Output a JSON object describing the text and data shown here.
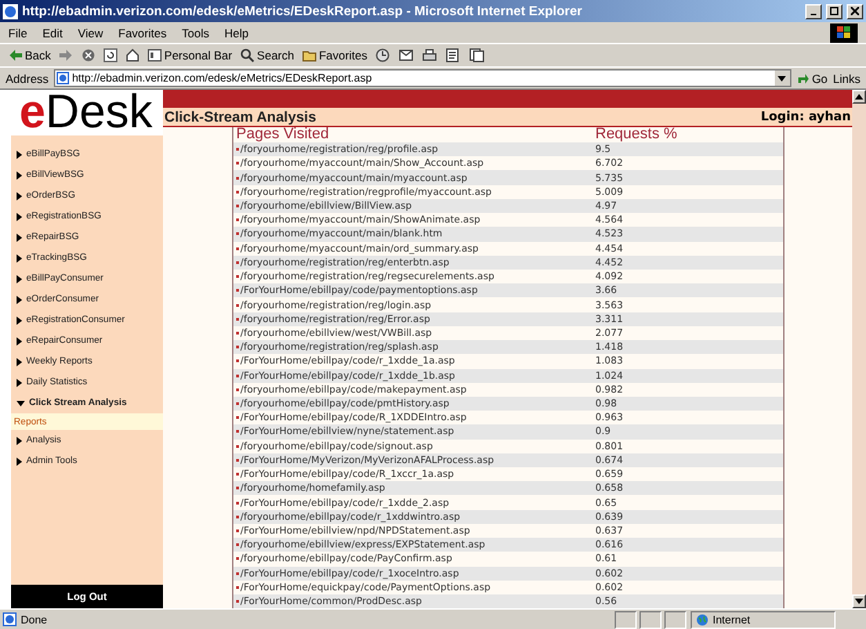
{
  "window": {
    "title": "http://ebadmin.verizon.com/edesk/eMetrics/EDeskReport.asp - Microsoft Internet Explorer"
  },
  "menu": [
    "File",
    "Edit",
    "View",
    "Favorites",
    "Tools",
    "Help"
  ],
  "toolbar": {
    "buttons": [
      {
        "label": "Back"
      },
      {
        "label": "Personal Bar"
      },
      {
        "label": "Search"
      },
      {
        "label": "Favorites"
      }
    ]
  },
  "address_bar": {
    "label": "Address",
    "value": "http://ebadmin.verizon.com/edesk/eMetrics/EDeskReport.asp",
    "go": "Go",
    "links": "Links"
  },
  "page": {
    "logo": {
      "accent": "e",
      "text": "Desk"
    },
    "heading": "Click-Stream Analysis",
    "login": "Login: ayhan",
    "sidebar": {
      "items": [
        {
          "label": "eBillPayBSG",
          "expanded": false,
          "selected": false
        },
        {
          "label": "eBillViewBSG",
          "expanded": false,
          "selected": false
        },
        {
          "label": "eOrderBSG",
          "expanded": false,
          "selected": false
        },
        {
          "label": "eRegistrationBSG",
          "expanded": false,
          "selected": false
        },
        {
          "label": "eRepairBSG",
          "expanded": false,
          "selected": false
        },
        {
          "label": "eTrackingBSG",
          "expanded": false,
          "selected": false
        },
        {
          "label": "eBillPayConsumer",
          "expanded": false,
          "selected": false
        },
        {
          "label": "eOrderConsumer",
          "expanded": false,
          "selected": false
        },
        {
          "label": "eRegistrationConsumer",
          "expanded": false,
          "selected": false
        },
        {
          "label": "eRepairConsumer",
          "expanded": false,
          "selected": false
        },
        {
          "label": "Weekly Reports",
          "expanded": false,
          "selected": false
        },
        {
          "label": "Daily Statistics",
          "expanded": false,
          "selected": false
        },
        {
          "label": "Click Stream Analysis",
          "expanded": true,
          "selected": false,
          "children": [
            {
              "label": "Reports",
              "selected": true
            }
          ]
        },
        {
          "label": "Analysis",
          "expanded": false,
          "selected": false
        },
        {
          "label": "Admin Tools",
          "expanded": false,
          "selected": false
        }
      ],
      "logout": "Log Out"
    },
    "table": {
      "columns": [
        "Pages Visited",
        "Requests %"
      ],
      "rows": [
        [
          "/foryourhome/registration/reg/profile.asp",
          "9.5"
        ],
        [
          "/foryourhome/myaccount/main/Show_Account.asp",
          "6.702"
        ],
        [
          "/foryourhome/myaccount/main/myaccount.asp",
          "5.735"
        ],
        [
          "/foryourhome/registration/regprofile/myaccount.asp",
          "5.009"
        ],
        [
          "/foryourhome/ebillview/BillView.asp",
          "4.97"
        ],
        [
          "/foryourhome/myaccount/main/ShowAnimate.asp",
          "4.564"
        ],
        [
          "/foryourhome/myaccount/main/blank.htm",
          "4.523"
        ],
        [
          "/foryourhome/myaccount/main/ord_summary.asp",
          "4.454"
        ],
        [
          "/foryourhome/registration/reg/enterbtn.asp",
          "4.452"
        ],
        [
          "/foryourhome/registration/reg/regsecurelements.asp",
          "4.092"
        ],
        [
          "/ForYourHome/ebillpay/code/paymentoptions.asp",
          "3.66"
        ],
        [
          "/foryourhome/registration/reg/login.asp",
          "3.563"
        ],
        [
          "/foryourhome/registration/reg/Error.asp",
          "3.311"
        ],
        [
          "/foryourhome/ebillview/west/VWBill.asp",
          "2.077"
        ],
        [
          "/foryourhome/registration/reg/splash.asp",
          "1.418"
        ],
        [
          "/ForYourHome/ebillpay/code/r_1xdde_1a.asp",
          "1.083"
        ],
        [
          "/ForYourHome/ebillpay/code/r_1xdde_1b.asp",
          "1.024"
        ],
        [
          "/foryourhome/ebillpay/code/makepayment.asp",
          "0.982"
        ],
        [
          "/foryourhome/ebillpay/code/pmtHistory.asp",
          "0.98"
        ],
        [
          "/ForYourHome/ebillpay/code/R_1XDDEIntro.asp",
          "0.963"
        ],
        [
          "/ForYourHome/ebillview/nyne/statement.asp",
          "0.9"
        ],
        [
          "/foryourhome/ebillpay/code/signout.asp",
          "0.801"
        ],
        [
          "/ForYourHome/MyVerizon/MyVerizonAFALProcess.asp",
          "0.674"
        ],
        [
          "/ForYourHome/ebillpay/code/R_1xccr_1a.asp",
          "0.659"
        ],
        [
          "/foryourhome/homefamily.asp",
          "0.658"
        ],
        [
          "/ForYourHome/ebillpay/code/r_1xdde_2.asp",
          "0.65"
        ],
        [
          "/foryourhome/ebillpay/code/r_1xddwintro.asp",
          "0.639"
        ],
        [
          "/ForYourHome/ebillview/npd/NPDStatement.asp",
          "0.637"
        ],
        [
          "/foryourhome/ebillview/express/EXPStatement.asp",
          "0.616"
        ],
        [
          "/foryourhome/ebillpay/code/PayConfirm.asp",
          "0.61"
        ],
        [
          "/ForYourHome/ebillpay/code/r_1xoceIntro.asp",
          "0.602"
        ],
        [
          "/ForYourHome/equickpay/code/PaymentOptions.asp",
          "0.602"
        ],
        [
          "/ForYourHome/common/ProdDesc.asp",
          "0.56"
        ]
      ]
    }
  },
  "status_bar": {
    "text": "Done",
    "zone": "Internet"
  }
}
